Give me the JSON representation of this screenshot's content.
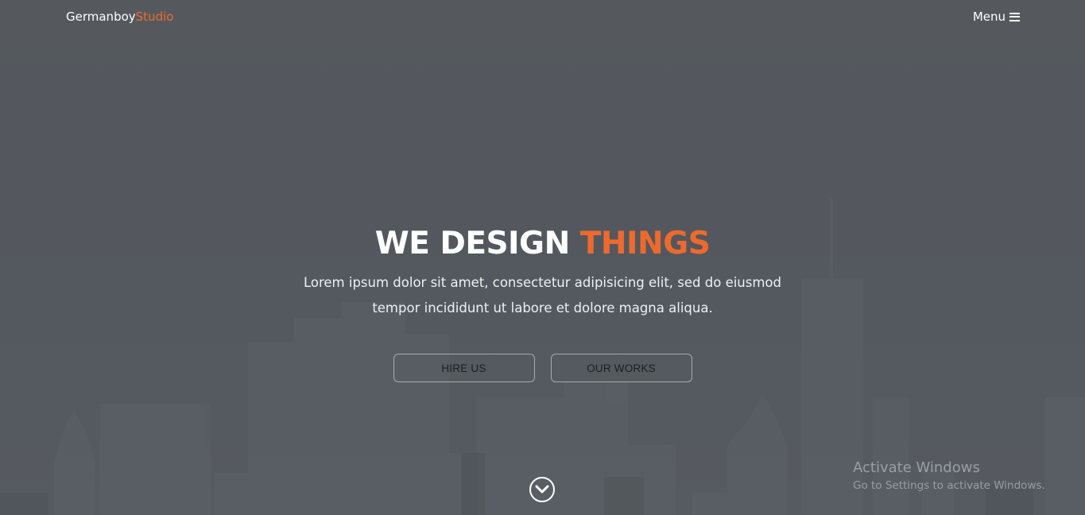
{
  "navbar": {
    "brand_main": "Germanboy",
    "brand_accent": "Studio",
    "menu_label": "Menu",
    "menu_icon": "hamburger-icon"
  },
  "hero": {
    "headline_main": "WE DESIGN",
    "headline_accent": "THINGS",
    "subtext": "Lorem ipsum dolor sit amet, consectetur adipisicing elit, sed do eiusmod tempor incididunt ut labore et dolore magna aliqua.",
    "buttons": [
      {
        "label": "HIRE US"
      },
      {
        "label": "OUR WORKS"
      }
    ],
    "scroll_icon": "chevron-down-circle-icon"
  },
  "watermark": {
    "title": "Activate Windows",
    "subtitle": "Go to Settings to activate Windows."
  },
  "colors": {
    "accent": "#ee6a2c",
    "background": "#585d63",
    "text": "#ffffff"
  }
}
